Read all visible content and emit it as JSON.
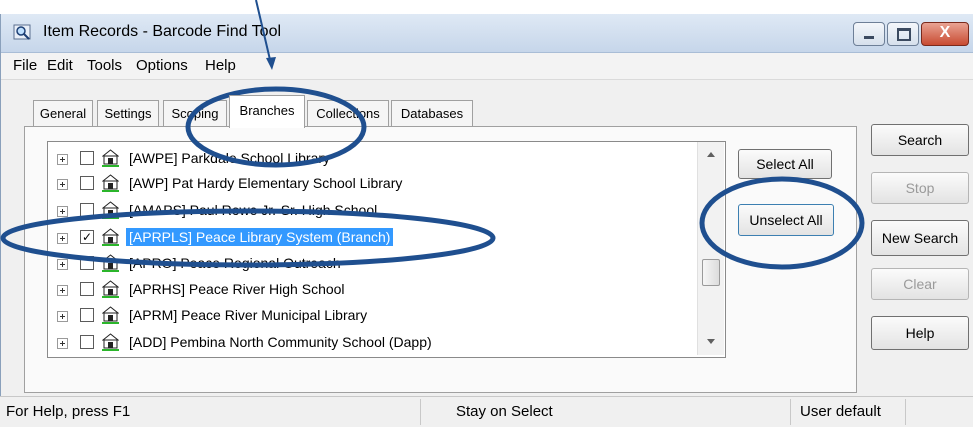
{
  "window": {
    "title": "Item Records - Barcode Find Tool",
    "controls": {
      "minimize": "minimize",
      "maximize": "maximize",
      "close": "X"
    }
  },
  "menu": [
    "File",
    "Edit",
    "Tools",
    "Options",
    "Help"
  ],
  "tabs": [
    "General",
    "Settings",
    "Scoping",
    "Branches",
    "Collections",
    "Databases"
  ],
  "active_tab": "Branches",
  "branches": [
    {
      "label": "[AWPE] Parkdale School Library",
      "checked": false,
      "selected": false
    },
    {
      "label": "[AWP] Pat Hardy Elementary School Library",
      "checked": false,
      "selected": false
    },
    {
      "label": "[AMAPS] Paul Rowe Jr.-Sr. High School",
      "checked": false,
      "selected": false
    },
    {
      "label": "[APRPLS] Peace Library System (Branch)",
      "checked": true,
      "selected": true
    },
    {
      "label": "[APRO] Peace Regional Outreach",
      "checked": false,
      "selected": false
    },
    {
      "label": "[APRHS] Peace River High School",
      "checked": false,
      "selected": false
    },
    {
      "label": "[APRM] Peace River Municipal Library",
      "checked": false,
      "selected": false
    },
    {
      "label": "[ADD] Pembina North Community School (Dapp)",
      "checked": false,
      "selected": false
    }
  ],
  "list_buttons": {
    "select_all": "Select All",
    "unselect_all": "Unselect All"
  },
  "side_buttons": {
    "search": "Search",
    "stop": "Stop",
    "new_search": "New Search",
    "clear": "Clear",
    "help": "Help"
  },
  "status": {
    "help": "For Help, press F1",
    "mode": "Stay on Select",
    "profile": "User default"
  },
  "icons": {
    "app": "search-magnifier-icon",
    "branch": "library-building-icon",
    "expander": "tree-expand-plus-icon"
  },
  "colors": {
    "annotation": "#1f4f8f",
    "selection": "#3399ff",
    "close_button": "#c84b32",
    "icon_underline": "#2bb52b"
  }
}
